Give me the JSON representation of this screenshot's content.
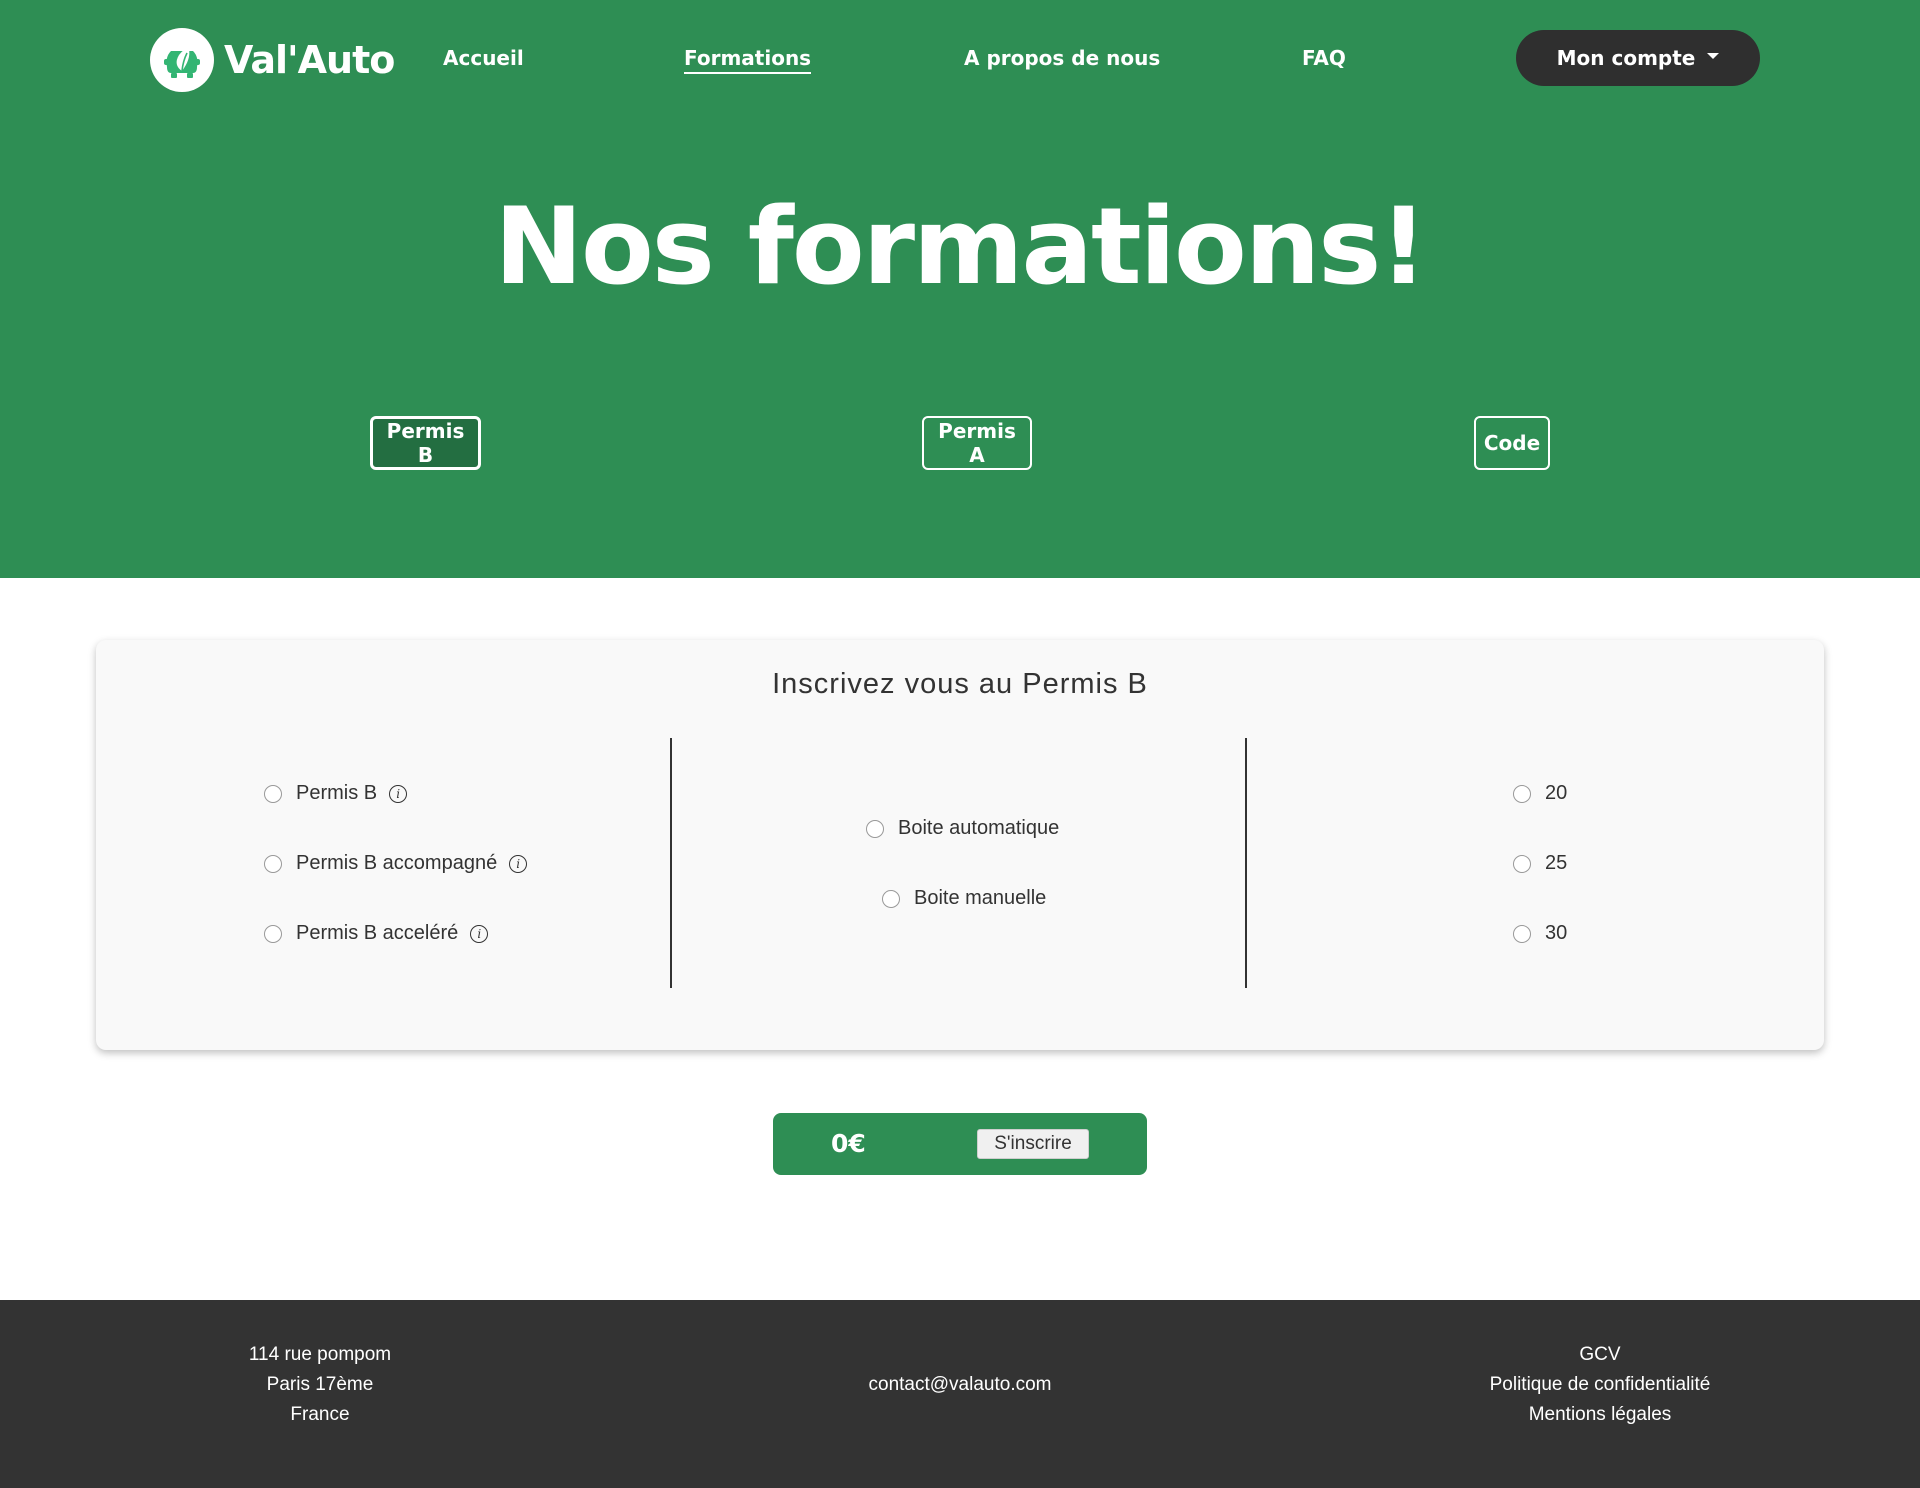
{
  "brand": {
    "name": "Val'Auto",
    "logo_icon": "leaf-car-icon",
    "color": "#2e8e54"
  },
  "nav": {
    "items": [
      {
        "label": "Accueil",
        "active": false
      },
      {
        "label": "Formations",
        "active": true
      },
      {
        "label": "A propos de nous",
        "active": false
      },
      {
        "label": "FAQ",
        "active": false
      }
    ],
    "account_label": "Mon compte"
  },
  "hero": {
    "title": "Nos formations!",
    "tabs": [
      {
        "label": "Permis B",
        "selected": true
      },
      {
        "label": "Permis A",
        "selected": false
      },
      {
        "label": "Code",
        "selected": false
      }
    ]
  },
  "form": {
    "title": "Inscrivez vous au Permis B",
    "licence_options": [
      {
        "label": "Permis B",
        "info_icon": "info-icon"
      },
      {
        "label": "Permis B accompagné",
        "info_icon": "info-icon"
      },
      {
        "label": "Permis B acceléré",
        "info_icon": "info-icon"
      }
    ],
    "gearbox_options": [
      {
        "label": "Boite automatique"
      },
      {
        "label": "Boite manuelle"
      }
    ],
    "hours_options": [
      {
        "label": "20"
      },
      {
        "label": "25"
      },
      {
        "label": "30"
      }
    ]
  },
  "checkout": {
    "price": "0€",
    "submit_label": "S'inscrire"
  },
  "footer": {
    "address": [
      "114 rue pompom",
      "Paris 17ème",
      "France"
    ],
    "email": "contact@valauto.com",
    "links": [
      "GCV",
      "Politique de confidentialité",
      "Mentions légales"
    ],
    "background": "#333333"
  }
}
